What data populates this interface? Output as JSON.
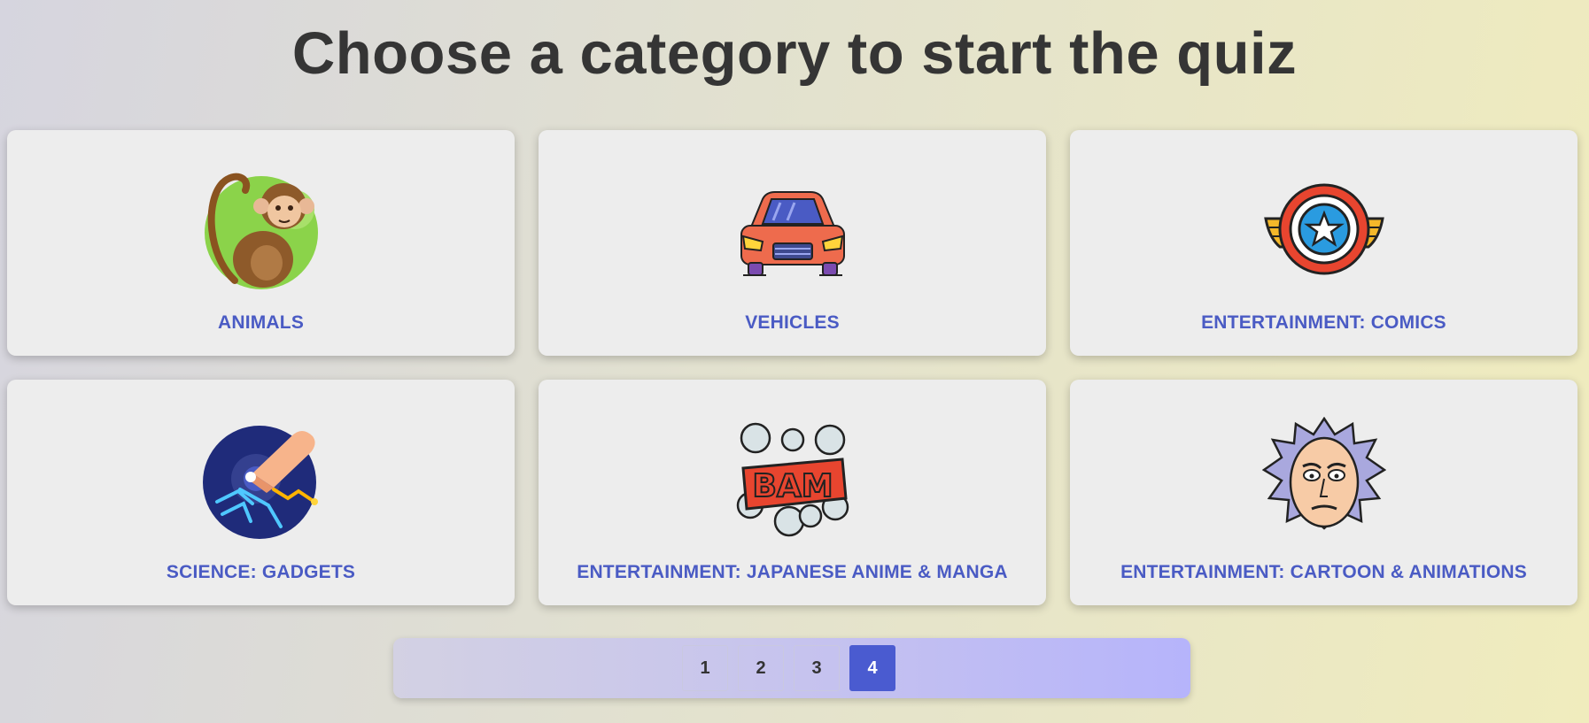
{
  "page": {
    "title": "Choose a category to start the quiz"
  },
  "categories": [
    {
      "label": "ANIMALS",
      "icon": "monkey-icon"
    },
    {
      "label": "VEHICLES",
      "icon": "car-icon"
    },
    {
      "label": "ENTERTAINMENT: COMICS",
      "icon": "comic-badge-icon"
    },
    {
      "label": "SCIENCE: GADGETS",
      "icon": "touch-gadget-icon"
    },
    {
      "label": "ENTERTAINMENT: JAPANESE ANIME & MANGA",
      "icon": "bam-burst-icon"
    },
    {
      "label": "ENTERTAINMENT: CARTOON & ANIMATIONS",
      "icon": "cartoon-scientist-icon"
    }
  ],
  "pagination": {
    "pages": [
      "1",
      "2",
      "3",
      "4"
    ],
    "current": "4"
  },
  "colors": {
    "accent": "#4a5bd0",
    "label": "#4a5bc4",
    "title": "#353535",
    "card": "#ededed"
  }
}
